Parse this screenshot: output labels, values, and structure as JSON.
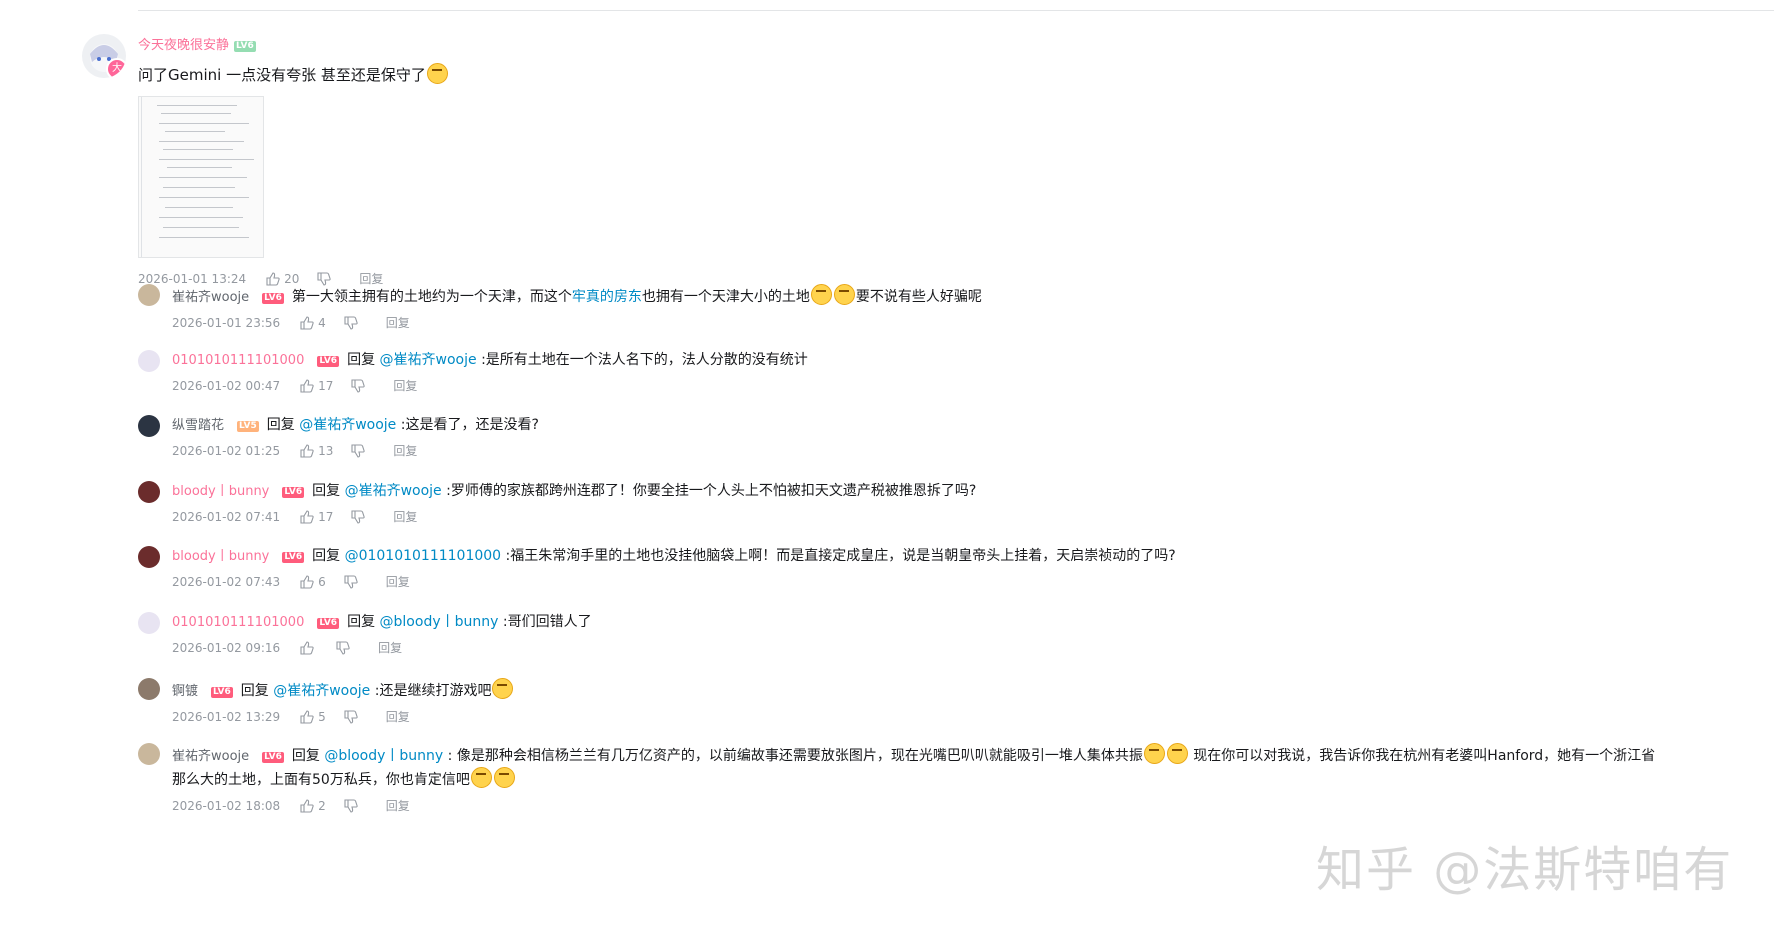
{
  "main_comment": {
    "username": "今天夜晚很安静",
    "level": "LV6",
    "avatar_badge": "大",
    "text": "问了Gemini 一点没有夸张 甚至还是保守了",
    "time": "2026-01-01 13:24",
    "likes": "20",
    "reply_label": "回复"
  },
  "replies": [
    {
      "user": "崔祐齐wooje",
      "user_color": "plain",
      "level": "LV6",
      "prefix": "",
      "at": "",
      "text": "第一大领主拥有的土地约为一个天津，而这个",
      "link": "牢真的房东",
      "text2": "也拥有一个天津大小的土地",
      "text3": "要不说有些人好骗呢",
      "time": "2026-01-01 23:56",
      "likes": "4"
    },
    {
      "user": "0101010111101000",
      "user_color": "pink",
      "level": "LV6",
      "prefix": "回复",
      "at": "@崔祐齐wooje",
      "text": ":是所有土地在一个法人名下的，法人分散的没有统计",
      "time": "2026-01-02 00:47",
      "likes": "17"
    },
    {
      "user": "纵雪踏花",
      "user_color": "plain",
      "level": "LV5",
      "prefix": "回复",
      "at": "@崔祐齐wooje",
      "text": ":这是看了，还是没看?",
      "time": "2026-01-02 01:25",
      "likes": "13"
    },
    {
      "user": "bloody丨bunny",
      "user_color": "pink",
      "level": "LV6",
      "prefix": "回复",
      "at": "@崔祐齐wooje",
      "text": ":罗师傅的家族都跨州连郡了！你要全挂一个人头上不怕被扣天文遗产税被推恩拆了吗?",
      "time": "2026-01-02 07:41",
      "likes": "17"
    },
    {
      "user": "bloody丨bunny",
      "user_color": "pink",
      "level": "LV6",
      "prefix": "回复",
      "at": "@0101010111101000",
      "text": ":福王朱常洵手里的土地也没挂他脑袋上啊！而是直接定成皇庄，说是当朝皇帝头上挂着，天启崇祯动的了吗?",
      "time": "2026-01-02 07:43",
      "likes": "6"
    },
    {
      "user": "0101010111101000",
      "user_color": "pink",
      "level": "LV6",
      "prefix": "回复",
      "at": "@bloody丨bunny",
      "text": ":哥们回错人了",
      "time": "2026-01-02 09:16",
      "likes": ""
    },
    {
      "user": "锕镀",
      "user_color": "plain",
      "level": "LV6",
      "prefix": "回复",
      "at": "@崔祐齐wooje",
      "text": ":还是继续打游戏吧",
      "time": "2026-01-02 13:29",
      "likes": "5"
    },
    {
      "user": "崔祐齐wooje",
      "user_color": "plain",
      "level": "LV6",
      "prefix": "回复",
      "at": "@bloody丨bunny",
      "text": ": 像是那种会相信杨兰兰有几万亿资产的，以前编故事还需要放张图片，现在光嘴巴叭叭就能吸引一堆人集体共振",
      "text2": "现在你可以对我说，我告诉你我在杭州有老婆叫Hanford，她有一个浙江省",
      "line2": "那么大的土地，上面有50万私兵，你也肯定信吧",
      "time": "2026-01-02 18:08",
      "likes": "2"
    }
  ],
  "reply_label": "回复",
  "watermark": "知乎 @法斯特咱有",
  "colors": {
    "pink": "#fb7299",
    "link": "#008ac5",
    "meta": "#9499a0"
  }
}
